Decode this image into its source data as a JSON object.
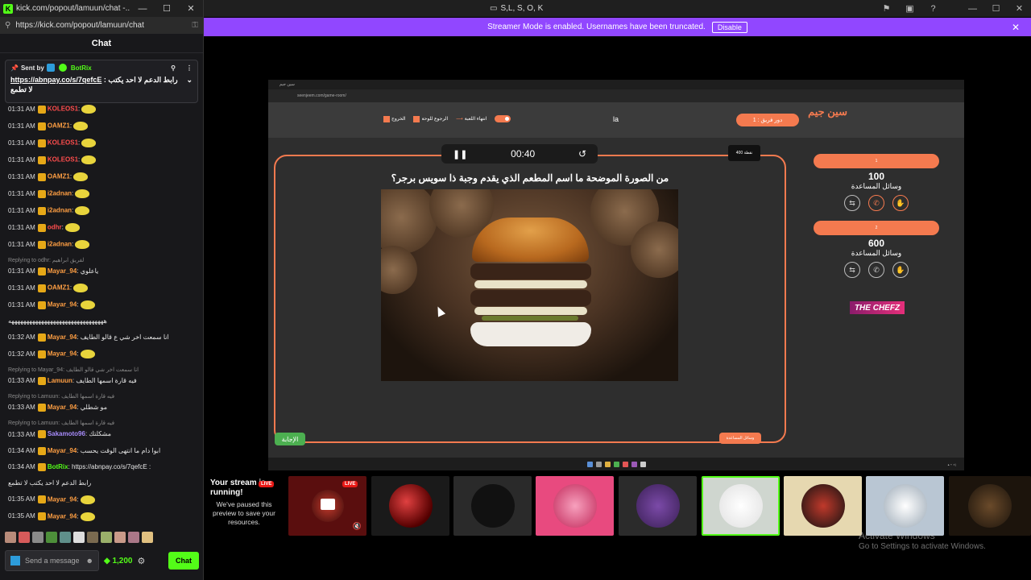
{
  "popout": {
    "window_title": "kick.com/popout/lamuun/chat -...",
    "url": "https://kick.com/popout/lamuun/chat",
    "header": "Chat",
    "pinned": {
      "sent_by": "Sent by",
      "bot": "BotRix",
      "text_prefix": "https://abnpay.co/s/7qefcE",
      "text_suffix": ": رابط الدعم لا احد يكتب",
      "text_line2": "لا تطمع"
    },
    "messages": [
      {
        "time": "01:31 AM",
        "user": "KOLEOS1",
        "color": "#ff4d4d",
        "text": ":"
      },
      {
        "time": "01:31 AM",
        "user": "OAMZ1",
        "color": "#ff9f43",
        "text": ":"
      },
      {
        "time": "01:31 AM",
        "user": "KOLEOS1",
        "color": "#ff4d4d",
        "text": ":"
      },
      {
        "time": "01:31 AM",
        "user": "KOLEOS1",
        "color": "#ff4d4d",
        "text": ":"
      },
      {
        "time": "01:31 AM",
        "user": "OAMZ1",
        "color": "#ff9f43",
        "text": ":"
      },
      {
        "time": "01:31 AM",
        "user": "i2adnan",
        "color": "#ff9f43",
        "text": ":"
      },
      {
        "time": "01:31 AM",
        "user": "i2adnan",
        "color": "#ff9f43",
        "text": ":"
      },
      {
        "time": "01:31 AM",
        "user": "odhr",
        "color": "#ff4d4d",
        "text": ":"
      },
      {
        "time": "01:31 AM",
        "user": "i2adnan",
        "color": "#ff9f43",
        "text": ":"
      },
      {
        "reply": "Replying to odhr: لفريق ابراهيم",
        "time": "01:31 AM",
        "user": "Mayar_94",
        "color": "#ff9f43",
        "text": ": ياعلوي"
      },
      {
        "time": "01:31 AM",
        "user": "OAMZ1",
        "color": "#ff9f43",
        "text": ":"
      },
      {
        "time": "01:31 AM",
        "user": "Mayar_94",
        "color": "#ff9f43",
        "text": ":"
      },
      {
        "time": "",
        "user": "",
        "color": "#fff",
        "text": "ههههههههههههههههههههههههههههههههه"
      },
      {
        "time": "01:32 AM",
        "user": "Mayar_94",
        "color": "#ff9f43",
        "text": ": انا سمعت اخر شي ع قالو الطايف"
      },
      {
        "time": "01:32 AM",
        "user": "Mayar_94",
        "color": "#ff9f43",
        "text": ":"
      },
      {
        "reply": "Replying to Mayar_94: انا سمعت اخر شي قالو الطايف",
        "time": "01:33 AM",
        "user": "Lamuun",
        "color": "#ff9f43",
        "text": ": فيه قارة اسمها الطايف"
      },
      {
        "reply": "Replying to Lamuun: فيه قارة اسمها الطايف",
        "time": "01:33 AM",
        "user": "Mayar_94",
        "color": "#ff9f43",
        "text": ": مو شطلي"
      },
      {
        "reply": "Replying to Lamuun: فيه قارة اسمها الطايف",
        "time": "01:33 AM",
        "user": "Sakamoto96",
        "color": "#a78bfa",
        "text": ": مشكلتك"
      },
      {
        "time": "01:34 AM",
        "user": "Mayar_94",
        "color": "#ff9f43",
        "text": ": ابوا دام ما انتهى الوقت يحسب"
      },
      {
        "time": "01:34 AM",
        "user": "BotRix",
        "color": "#53fc18",
        "text": ": https://abnpay.co/s/7qefcE :"
      },
      {
        "time": "",
        "user": "",
        "color": "#fff",
        "text": "رابط الدعم لا احد يكتب لا تطمع"
      },
      {
        "time": "01:35 AM",
        "user": "Mayar_94",
        "color": "#ff9f43",
        "text": ":"
      },
      {
        "time": "01:35 AM",
        "user": "Mayar_94",
        "color": "#ff9f43",
        "text": ":"
      },
      {
        "time": "",
        "user": "",
        "color": "#fff",
        "text": "ههههههههههههههههههههههههههههههههه"
      }
    ],
    "send_placeholder": "Send a message",
    "points": "1,200",
    "chat_button": "Chat"
  },
  "topbar": {
    "center_title": "S,L, S, O, K"
  },
  "streamer_bar": {
    "text": "Streamer Mode is enabled. Usernames have been truncated.",
    "disable": "Disable"
  },
  "game": {
    "url": "seenjeem.com/game-room/",
    "logo": "سين جيم",
    "turn": "دور فريق : 1",
    "answer_field": "la",
    "menu": {
      "end_game": "انتهاء اللعبة",
      "back_board": "الرجوع للوحة",
      "exit": "الخروج"
    },
    "timer": "00:40",
    "points_badge": "400 نقطة",
    "question": "من الصورة الموضحة ما اسم المطعم الذي يقدم وجبة ذا سويس برجر؟",
    "answer_button": "الإجابة",
    "reveal_button": "وسائل المساعدة",
    "teams": [
      {
        "name": "1",
        "score": "100",
        "aids_label": "وسائل المساعدة"
      },
      {
        "name": "2",
        "score": "600",
        "aids_label": "وسائل المساعدة"
      }
    ],
    "sponsor": "THE CHEFZ"
  },
  "your_stream": {
    "title": "Your stream is running!",
    "subtitle": "We've paused this preview to save your resources.",
    "live": "LIVE"
  },
  "watermark": {
    "line1": "Activate Windows",
    "line2": "Go to Settings to activate Windows."
  }
}
